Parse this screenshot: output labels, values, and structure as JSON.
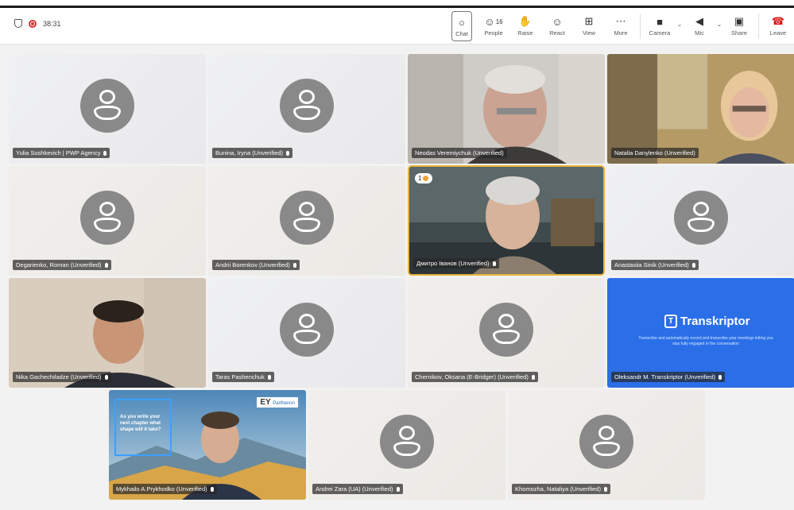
{
  "toolbar": {
    "timer": "38:31",
    "buttons": {
      "chat": "Chat",
      "people": "People",
      "people_count": "16",
      "raise": "Raise",
      "react": "React",
      "view": "View",
      "more": "More",
      "camera": "Camera",
      "mic": "Mic",
      "share": "Share",
      "leave": "Leave"
    }
  },
  "participants": [
    {
      "name": "Yulia Sushkevich | PWP Agency",
      "video": false
    },
    {
      "name": "Bunina, Iryna (Unverified)",
      "video": false
    },
    {
      "name": "Neodas Veremiychuk (Unverified)",
      "video": true
    },
    {
      "name": "Natalia Danylenko (Unverified)",
      "video": true
    },
    {
      "name": "Degarienko, Roman (Unverified)",
      "video": false
    },
    {
      "name": "Andrii Borenkov (Unverified)",
      "video": false
    },
    {
      "name": "Дмитро Іванов (Unverified)",
      "video": true,
      "rank": "1"
    },
    {
      "name": "Anastasiia Sinik (Unverified)",
      "video": false
    },
    {
      "name": "Nika Gachechiladze (Unverified)",
      "video": true
    },
    {
      "name": "Taras Pashenchuk",
      "video": false
    },
    {
      "name": "Chernikov, Oksana (E-Bridger) (Unverified)",
      "video": false
    },
    {
      "name": "Oleksandr M. Transkriptor (Unverified)",
      "video": true
    },
    {
      "name": "Mykhailo A.Prykhodko (Unverified)",
      "video": true
    },
    {
      "name": "Andrei Zara (UA) (Unverified)",
      "video": false
    },
    {
      "name": "Khomozha, Nataliya (Unverified)",
      "video": false
    }
  ],
  "transkriptor": {
    "logo": "Transkriptor",
    "tagline": "Transcribe and automatically record and transcribe your meetings letting you stay fully engaged in the conversation"
  },
  "ey": {
    "logo": "EY",
    "logo_sub": "Parthenon",
    "tagline": "As you write your next chapter what shape will it take?"
  },
  "colors": {
    "speaker_border": "#e6b33a",
    "leave": "#d11111",
    "transkriptor_bg": "#2a6fe8"
  }
}
